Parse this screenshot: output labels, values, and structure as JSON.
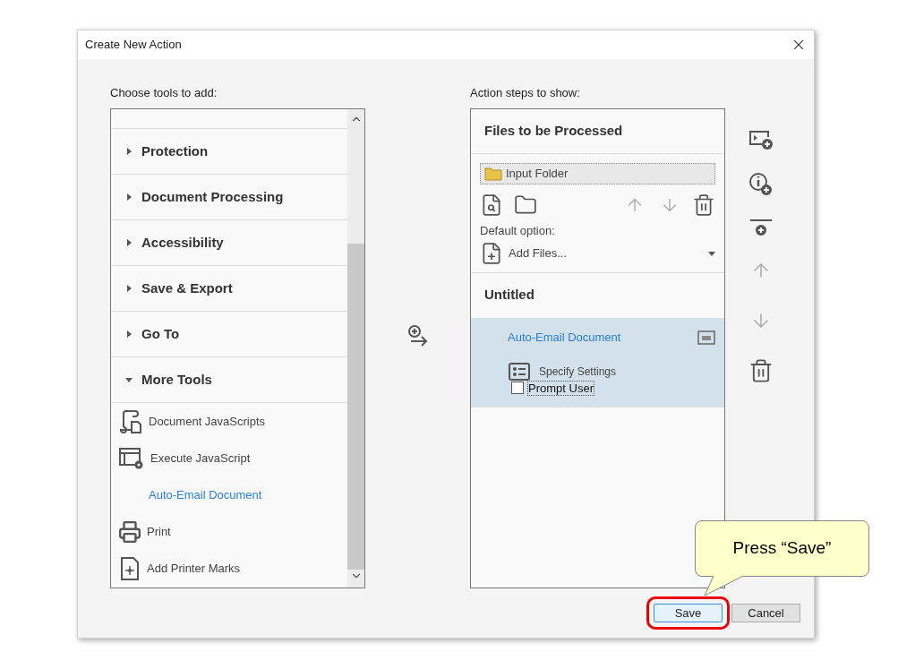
{
  "window": {
    "title": "Create New Action"
  },
  "tools_panel": {
    "label": "Choose tools to add:",
    "groups": [
      {
        "label": "Protection",
        "expanded": false
      },
      {
        "label": "Document Processing",
        "expanded": false
      },
      {
        "label": "Accessibility",
        "expanded": false
      },
      {
        "label": "Save & Export",
        "expanded": false
      },
      {
        "label": "Go To",
        "expanded": false
      },
      {
        "label": "More Tools",
        "expanded": true
      }
    ],
    "items": [
      {
        "label": "Document JavaScripts",
        "kind": "scripts",
        "selected": false
      },
      {
        "label": "Execute JavaScript",
        "kind": "execute",
        "selected": false
      },
      {
        "label": "Auto-Email Document",
        "kind": "plain",
        "selected": true
      },
      {
        "label": "Print",
        "kind": "print",
        "selected": false
      },
      {
        "label": "Add Printer Marks",
        "kind": "marks",
        "selected": false
      }
    ]
  },
  "steps_panel": {
    "label": "Action steps to show:",
    "files_title": "Files to be Processed",
    "input": "Input Folder",
    "default_label": "Default option:",
    "default_value": "Add Files...",
    "action_title": "Untitled",
    "step": {
      "label": "Auto-Email Document",
      "selected": true,
      "settings": "Specify Settings",
      "prompt": {
        "label": "Prompt User",
        "checked": false
      }
    }
  },
  "callout": "Press “Save”",
  "buttons": [
    {
      "label": "Save",
      "highlighted": true
    },
    {
      "label": "Cancel",
      "highlighted": false
    }
  ]
}
